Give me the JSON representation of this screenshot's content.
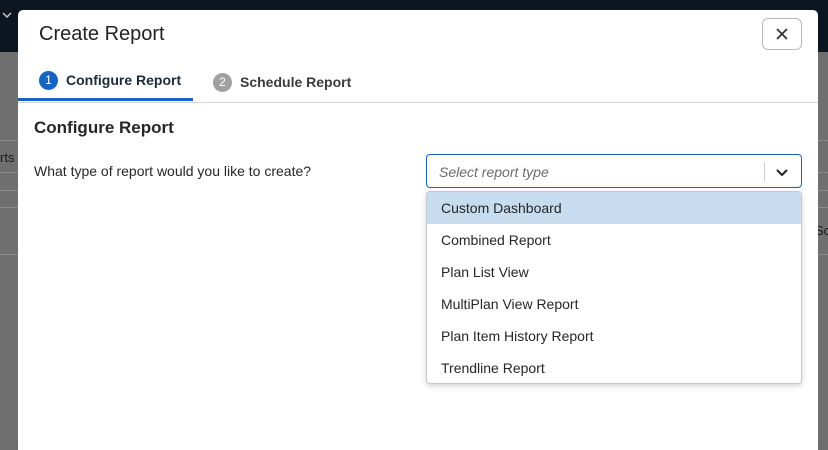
{
  "background": {
    "left_text": "rts",
    "right_text": "Sc"
  },
  "modal": {
    "title": "Create Report",
    "close_icon": "close-icon"
  },
  "tabs": [
    {
      "number": "1",
      "label": "Configure Report",
      "active": true
    },
    {
      "number": "2",
      "label": "Schedule Report",
      "active": false
    }
  ],
  "form": {
    "heading": "Configure Report",
    "question": "What type of report would you like to create?",
    "select": {
      "placeholder": "Select report type",
      "icon": "chevron-down-icon"
    },
    "options": [
      {
        "label": "Custom Dashboard",
        "highlighted": true
      },
      {
        "label": "Combined Report",
        "highlighted": false
      },
      {
        "label": "Plan List View",
        "highlighted": false
      },
      {
        "label": "MultiPlan View Report",
        "highlighted": false
      },
      {
        "label": "Plan Item History Report",
        "highlighted": false
      },
      {
        "label": "Trendline Report",
        "highlighted": false
      }
    ]
  },
  "colors": {
    "accent": "#1565c0",
    "highlight": "#c8dcf0",
    "overlay": "#6f6f6f"
  }
}
